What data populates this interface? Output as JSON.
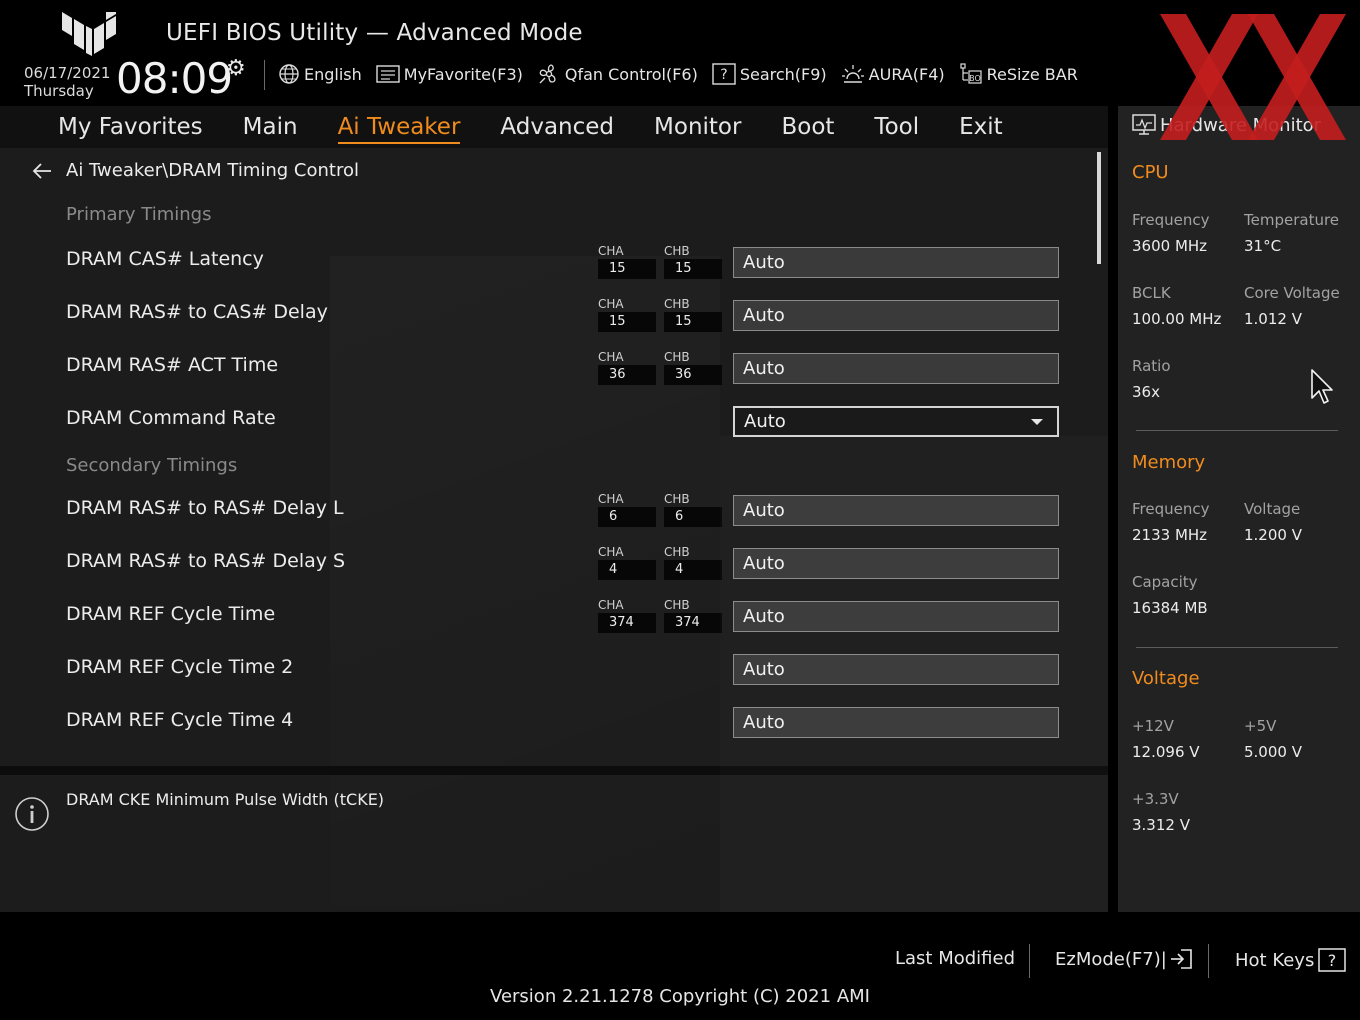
{
  "header": {
    "title": "UEFI BIOS Utility — Advanced Mode",
    "date": "06/17/2021",
    "day": "Thursday",
    "time": "08:09",
    "toolbar": [
      {
        "icon": "globe-icon",
        "label": "English"
      },
      {
        "icon": "favorite-icon",
        "label": "MyFavorite(F3)"
      },
      {
        "icon": "fan-icon",
        "label": "Qfan Control(F6)"
      },
      {
        "icon": "search-icon",
        "label": "Search(F9)"
      },
      {
        "icon": "aura-icon",
        "label": "AURA(F4)"
      },
      {
        "icon": "resize-bar-icon",
        "label": "ReSize BAR"
      }
    ]
  },
  "nav": {
    "tabs": [
      "My Favorites",
      "Main",
      "Ai Tweaker",
      "Advanced",
      "Monitor",
      "Boot",
      "Tool",
      "Exit"
    ],
    "active": "Ai Tweaker",
    "accent": "#f08c1e"
  },
  "breadcrumb": "Ai Tweaker\\DRAM Timing Control",
  "sections": {
    "primary": "Primary Timings",
    "secondary": "Secondary Timings"
  },
  "rows": [
    {
      "label": "DRAM CAS# Latency",
      "cha_label": "CHA",
      "cha": "15",
      "chb_label": "CHB",
      "chb": "15",
      "value": "Auto"
    },
    {
      "label": "DRAM RAS# to CAS# Delay",
      "cha_label": "CHA",
      "cha": "15",
      "chb_label": "CHB",
      "chb": "15",
      "value": "Auto"
    },
    {
      "label": "DRAM RAS# ACT Time",
      "cha_label": "CHA",
      "cha": "36",
      "chb_label": "CHB",
      "chb": "36",
      "value": "Auto"
    },
    {
      "label": "DRAM Command Rate",
      "value": "Auto"
    },
    {
      "label": "DRAM RAS# to RAS# Delay L",
      "cha_label": "CHA",
      "cha": "6",
      "chb_label": "CHB",
      "chb": "6",
      "value": "Auto"
    },
    {
      "label": "DRAM RAS# to RAS# Delay S",
      "cha_label": "CHA",
      "cha": "4",
      "chb_label": "CHB",
      "chb": "4",
      "value": "Auto"
    },
    {
      "label": "DRAM REF Cycle Time",
      "cha_label": "CHA",
      "cha": "374",
      "chb_label": "CHB",
      "chb": "374",
      "value": "Auto"
    },
    {
      "label": "DRAM REF Cycle Time 2",
      "value": "Auto"
    },
    {
      "label": "DRAM REF Cycle Time 4",
      "value": "Auto"
    }
  ],
  "help": {
    "text": "DRAM CKE Minimum Pulse Width (tCKE)"
  },
  "hardware_monitor": {
    "title": "Hardware Monitor",
    "cpu": {
      "title": "CPU",
      "frequency_label": "Frequency",
      "frequency": "3600 MHz",
      "temperature_label": "Temperature",
      "temperature": "31°C",
      "bclk_label": "BCLK",
      "bclk": "100.00 MHz",
      "core_voltage_label": "Core Voltage",
      "core_voltage": "1.012 V",
      "ratio_label": "Ratio",
      "ratio": "36x"
    },
    "memory": {
      "title": "Memory",
      "frequency_label": "Frequency",
      "frequency": "2133 MHz",
      "voltage_label": "Voltage",
      "voltage": "1.200 V",
      "capacity_label": "Capacity",
      "capacity": "16384 MB"
    },
    "voltage": {
      "title": "Voltage",
      "v12_label": "+12V",
      "v12": "12.096 V",
      "v5_label": "+5V",
      "v5": "5.000 V",
      "v33_label": "+3.3V",
      "v33": "3.312 V"
    }
  },
  "footer": {
    "last_modified": "Last Modified",
    "ezmode": "EzMode(F7)|",
    "hotkeys": "Hot Keys",
    "version": "Version 2.21.1278 Copyright (C) 2021 AMI"
  }
}
